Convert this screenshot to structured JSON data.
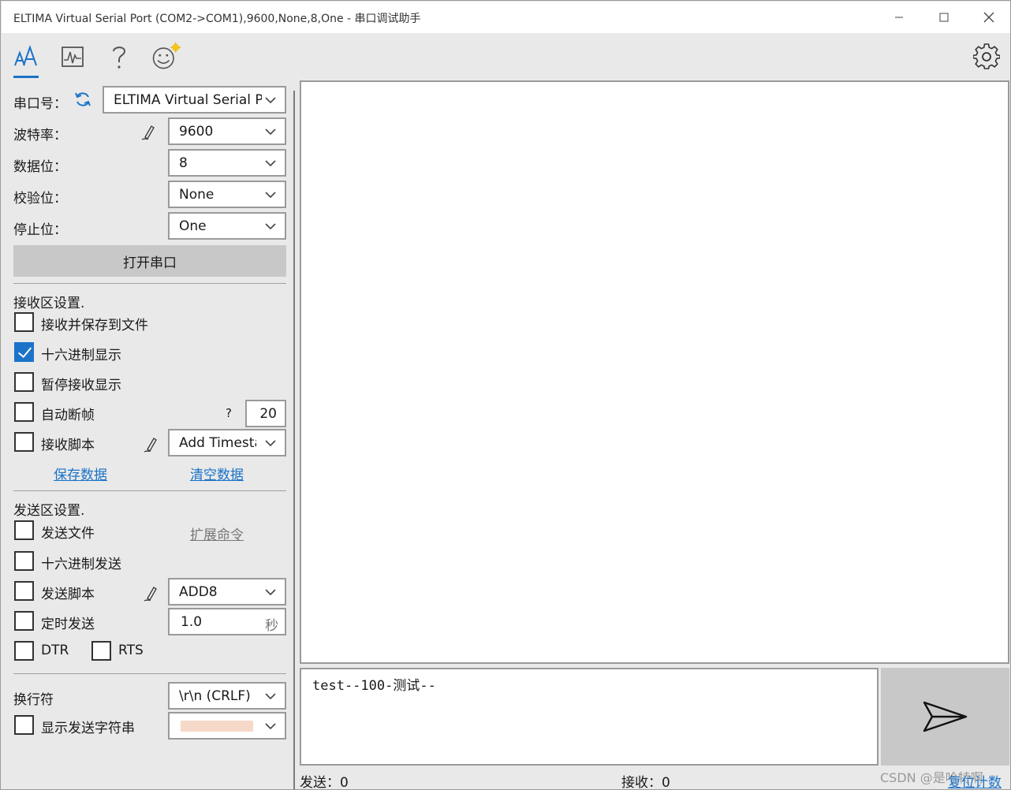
{
  "window": {
    "title": "ELTIMA Virtual Serial Port (COM2->COM1),9600,None,8,One - 串口调试助手",
    "minimize_icon": "minimize-icon",
    "maximize_icon": "maximize-icon",
    "close_icon": "close-icon"
  },
  "toolbar": {
    "icons": [
      "font-size-icon",
      "chart-icon",
      "help-icon",
      "smiley-icon",
      "gear-icon"
    ],
    "accent": "#1a73c8"
  },
  "serial": {
    "port_label": "串口号：",
    "port_value": "ELTIMA Virtual Serial Port",
    "baud_label": "波特率：",
    "baud_value": "9600",
    "databits_label": "数据位：",
    "databits_value": "8",
    "parity_label": "校验位：",
    "parity_value": "None",
    "stopbits_label": "停止位：",
    "stopbits_value": "One",
    "open_button": "打开串口"
  },
  "receive_settings": {
    "title": "接收区设置.",
    "save_to_file": "接收并保存到文件",
    "hex_display": "十六进制显示",
    "pause_display": "暂停接收显示",
    "auto_frame": "自动断帧",
    "auto_frame_help": "?",
    "auto_frame_value": "20",
    "recv_script": "接收脚本",
    "recv_script_value": "Add Timestamp",
    "save_data": "保存数据",
    "clear_data": "清空数据",
    "checked": {
      "save_to_file": false,
      "hex_display": true,
      "pause_display": false,
      "auto_frame": false,
      "recv_script": false
    }
  },
  "send_settings": {
    "title": "发送区设置.",
    "send_file": "发送文件",
    "extend_cmd": "扩展命令",
    "hex_send": "十六进制发送",
    "send_script": "发送脚本",
    "send_script_value": "ADD8",
    "timed_send": "定时发送",
    "timed_value": "1.0",
    "timed_unit": "秒",
    "dtr": "DTR",
    "rts": "RTS",
    "newline_label": "换行符",
    "newline_value": "\\r\\n (CRLF)",
    "show_send_string": "显示发送字符串",
    "color_swatch": "#f6d9c8"
  },
  "main": {
    "send_text": "test--100-测试--",
    "send_icon": "send-icon"
  },
  "status": {
    "sent": "发送：0",
    "received": "接收：0",
    "reset": "复位计数"
  },
  "watermark": "CSDN @是哈特啊"
}
